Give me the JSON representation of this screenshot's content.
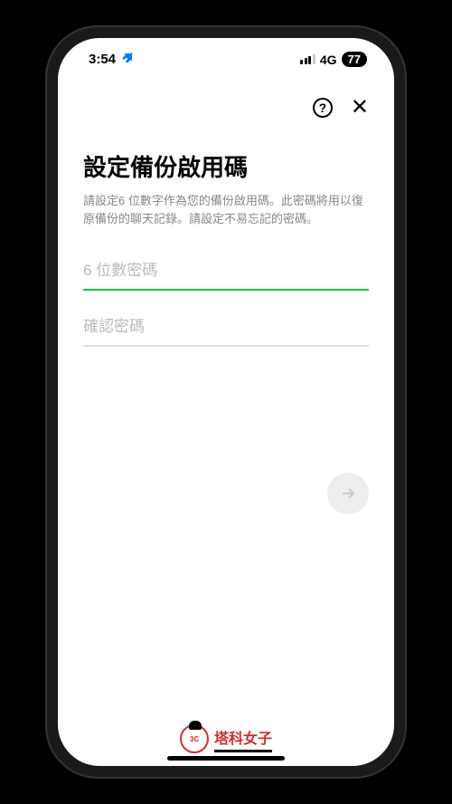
{
  "statusBar": {
    "time": "3:54",
    "network": "4G",
    "battery": "77"
  },
  "topActions": {
    "helpLabel": "?",
    "closeLabel": "✕"
  },
  "page": {
    "title": "設定備份啟用碼",
    "description": "請設定6 位數字作為您的備份啟用碼。此密碼將用以復原備份的聊天記錄。請設定不易忘記的密碼。"
  },
  "inputs": {
    "password": {
      "placeholder": "6 位數密碼",
      "value": ""
    },
    "confirm": {
      "placeholder": "確認密碼",
      "value": ""
    }
  },
  "watermark": {
    "badge": "3C",
    "text": "塔科女子"
  }
}
